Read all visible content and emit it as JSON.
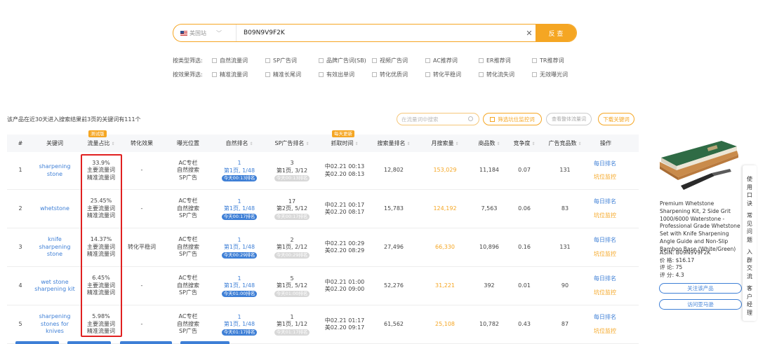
{
  "search": {
    "site": "美国站",
    "asin": "B09N9V9F2K",
    "button": "反 查"
  },
  "filters": {
    "type_label": "按类型筛选:",
    "type_options": [
      "自然流量词",
      "SP广告词",
      "品牌广告词(SB)",
      "视频广告词",
      "AC推荐词",
      "ER推荐词",
      "TR推荐词"
    ],
    "effect_label": "按效果筛选:",
    "effect_options": [
      "精准流量词",
      "精准长尾词",
      "有效出单词",
      "转化优质词",
      "转化平稳词",
      "转化流失词",
      "无效曝光词"
    ]
  },
  "toolbar": {
    "summary": "该产品在近30天进入搜索结果前3页的关键词有111个",
    "filter_placeholder": "在流量词中搜索",
    "monitor_label": "筛选坑位监控词",
    "overall_label": "查看整体流量词",
    "download_label": "下载关键词"
  },
  "table": {
    "headers": [
      "#",
      "关键词",
      "流量占比",
      "转化效果",
      "曝光位置",
      "自然排名",
      "SP广告排名",
      "抓取时间",
      "搜索量排名",
      "月搜索量",
      "商品数",
      "竞争度",
      "广告竞品数",
      "操作"
    ],
    "badge_test": "测试版",
    "badge_daily": "每天更新",
    "rows": [
      {
        "n": "1",
        "kw": "sharpening stone",
        "share": "33.9%",
        "share_t1": "主要流量词",
        "share_t2": "精准流量词",
        "conv": "-",
        "exp1": "AC专栏",
        "exp2": "自然搜索",
        "exp3": "SP广告",
        "nat": "1",
        "nat_page": "第1页, 1/48",
        "nat_pill": "今天00:13排名",
        "sp": "3",
        "sp_page": "第1页, 3/12",
        "sp_pill": "今天00:13排名",
        "t1": "中02.21 00:13",
        "t2": "美02.20 08:13",
        "srank": "12,802",
        "msearch": "153,029",
        "prod": "11,184",
        "comp": "0.07",
        "ads": "131",
        "op1": "每日排名",
        "op2": "坑位监控"
      },
      {
        "n": "2",
        "kw": "whetstone",
        "share": "25.45%",
        "share_t1": "主要流量词",
        "share_t2": "精准流量词",
        "conv": "-",
        "exp1": "AC专栏",
        "exp2": "自然搜索",
        "exp3": "SP广告",
        "nat": "1",
        "nat_page": "第1页, 1/48",
        "nat_pill": "今天00:17排名",
        "sp": "17",
        "sp_page": "第2页, 5/12",
        "sp_pill": "今天00:17排名",
        "t1": "中02.21 00:17",
        "t2": "美02.20 08:17",
        "srank": "15,783",
        "msearch": "124,192",
        "prod": "7,563",
        "comp": "0.06",
        "ads": "83",
        "op1": "每日排名",
        "op2": "坑位监控"
      },
      {
        "n": "3",
        "kw": "knife sharpening stone",
        "share": "14.37%",
        "share_t1": "主要流量词",
        "share_t2": "精准流量词",
        "conv": "转化平稳词",
        "exp1": "AC专栏",
        "exp2": "自然搜索",
        "exp3": "SP广告",
        "nat": "1",
        "nat_page": "第1页, 1/48",
        "nat_pill": "今天00:29排名",
        "sp": "2",
        "sp_page": "第1页, 2/12",
        "sp_pill": "今天00:29排名",
        "t1": "中02.21 00:29",
        "t2": "美02.20 08:29",
        "srank": "27,496",
        "msearch": "66,330",
        "prod": "10,896",
        "comp": "0.16",
        "ads": "131",
        "op1": "每日排名",
        "op2": "坑位监控"
      },
      {
        "n": "4",
        "kw": "wet stone sharpening kit",
        "share": "6.45%",
        "share_t1": "主要流量词",
        "share_t2": "精准流量词",
        "conv": "-",
        "exp1": "AC专栏",
        "exp2": "自然搜索",
        "exp3": "SP广告",
        "nat": "1",
        "nat_page": "第1页, 1/48",
        "nat_pill": "今天01:00排名",
        "sp": "5",
        "sp_page": "第1页, 5/12",
        "sp_pill": "今天01:00排名",
        "t1": "中02.21 01:00",
        "t2": "美02.20 09:00",
        "srank": "52,276",
        "msearch": "31,221",
        "prod": "392",
        "comp": "0.01",
        "ads": "90",
        "op1": "每日排名",
        "op2": "坑位监控"
      },
      {
        "n": "5",
        "kw": "sharpening stones for knives",
        "share": "5.98%",
        "share_t1": "主要流量词",
        "share_t2": "精准流量词",
        "conv": "-",
        "exp1": "AC专栏",
        "exp2": "自然搜索",
        "exp3": "SP广告",
        "nat": "1",
        "nat_page": "第1页, 1/48",
        "nat_pill": "今天01:17排名",
        "sp": "1",
        "sp_page": "第1页, 1/12",
        "sp_pill": "今天01:17排名",
        "t1": "中02.21 01:17",
        "t2": "美02.20 09:17",
        "srank": "61,562",
        "msearch": "25,108",
        "prod": "10,782",
        "comp": "0.43",
        "ads": "87",
        "op1": "每日排名",
        "op2": "坑位监控"
      }
    ]
  },
  "product": {
    "title": "Premium Whetstone Sharpening Kit, 2 Side Grit 1000/6000 Waterstone - Professional Grade Whetstone Set with Knife Sharpening Angle Guide and Non-Slip Bamboo Base (White/Green)",
    "asin": "ASIN:  B09N9V9F2K",
    "price": "价 格:  $16.17",
    "reviews": "评 论:  75",
    "rating": "评 分:  4.3",
    "follow_button": "关注该产品",
    "visit_button": "访问亚马逊"
  },
  "side_panel": {
    "g1": [
      "使",
      "用",
      "口",
      "诀"
    ],
    "g2": [
      "常",
      "见",
      "问",
      "题"
    ],
    "g3": [
      "入",
      "群",
      "交",
      "流"
    ],
    "g4": [
      "客",
      "户",
      "经",
      "理"
    ]
  },
  "colors": {
    "accent": "#f5a623",
    "link": "#3e7fd6",
    "highlight": "#e02020"
  }
}
